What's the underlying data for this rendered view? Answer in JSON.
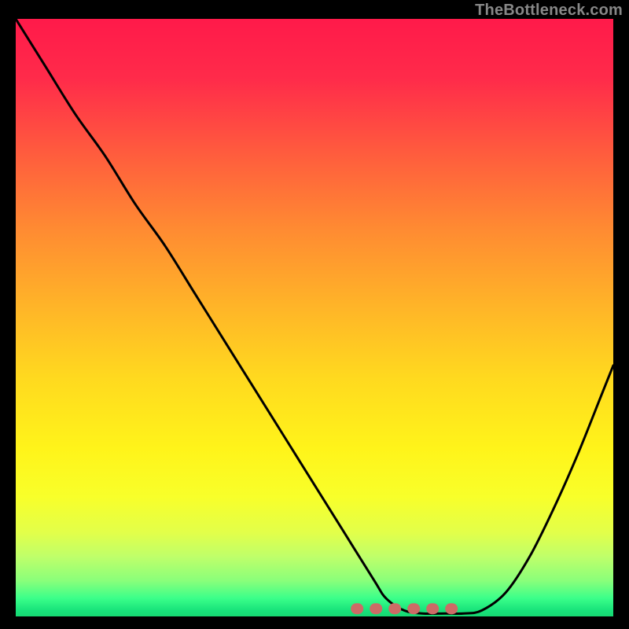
{
  "watermark": "TheBottleneck.com",
  "chart_data": {
    "type": "line",
    "title": "",
    "xlabel": "",
    "ylabel": "",
    "xlim": [
      0,
      100
    ],
    "ylim": [
      0,
      100
    ],
    "background_gradient": {
      "top_color": "#ff1a4a",
      "mid_color": "#ffd91f",
      "bottom_color": "#16d872"
    },
    "series": [
      {
        "name": "bottleneck-curve",
        "x": [
          0,
          5,
          10,
          15,
          20,
          25,
          30,
          35,
          40,
          45,
          50,
          55,
          60,
          62,
          65,
          68,
          72,
          75,
          78,
          82,
          86,
          90,
          94,
          98,
          100
        ],
        "values": [
          100,
          92,
          84,
          77,
          69,
          62,
          54,
          46,
          38,
          30,
          22,
          14,
          6,
          3,
          1,
          0.5,
          0.5,
          0.5,
          1,
          4,
          10,
          18,
          27,
          37,
          42
        ]
      }
    ],
    "markers": [
      {
        "name": "flat-region-marker",
        "x_range": [
          57,
          75
        ],
        "y": 0.5,
        "color": "#cc6b66",
        "style": "rounded-thick-dashed"
      }
    ],
    "annotations": []
  }
}
